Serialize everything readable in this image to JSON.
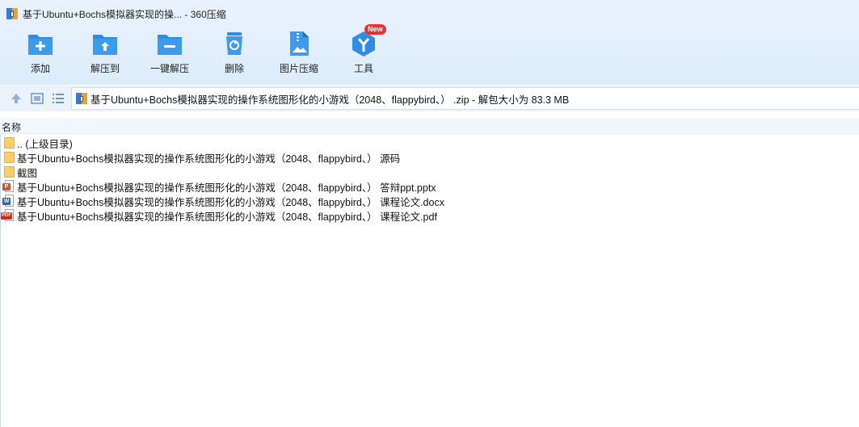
{
  "window": {
    "title": "基于Ubuntu+Bochs模拟器实现的操... - 360压缩"
  },
  "toolbar": {
    "items": [
      {
        "label": "添加",
        "icon": "add-folder-icon"
      },
      {
        "label": "解压到",
        "icon": "extract-to-icon"
      },
      {
        "label": "一键解压",
        "icon": "one-click-extract-icon"
      },
      {
        "label": "删除",
        "icon": "delete-icon"
      },
      {
        "label": "图片压缩",
        "icon": "image-compress-icon"
      },
      {
        "label": "工具",
        "icon": "tools-icon",
        "badge": "New"
      }
    ]
  },
  "nav": {
    "path": "基于Ubuntu+Bochs模拟器实现的操作系统图形化的小游戏（2048、flappybird、） .zip - 解包大小为 83.3 MB"
  },
  "columns": {
    "name": "名称"
  },
  "files": [
    {
      "name": ".. (上级目录)",
      "type": "folder"
    },
    {
      "name": "基于Ubuntu+Bochs模拟器实现的操作系统图形化的小游戏（2048、flappybird、） 源码",
      "type": "folder"
    },
    {
      "name": "截图",
      "type": "folder"
    },
    {
      "name": "基于Ubuntu+Bochs模拟器实现的操作系统图形化的小游戏（2048、flappybird、） 答辩ppt.pptx",
      "type": "pptx"
    },
    {
      "name": "基于Ubuntu+Bochs模拟器实现的操作系统图形化的小游戏（2048、flappybird、） 课程论文.docx",
      "type": "docx"
    },
    {
      "name": "基于Ubuntu+Bochs模拟器实现的操作系统图形化的小游戏（2048、flappybird、） 课程论文.pdf",
      "type": "pdf"
    }
  ],
  "colors": {
    "accent": "#2f8de4",
    "band": "#e4effb"
  }
}
